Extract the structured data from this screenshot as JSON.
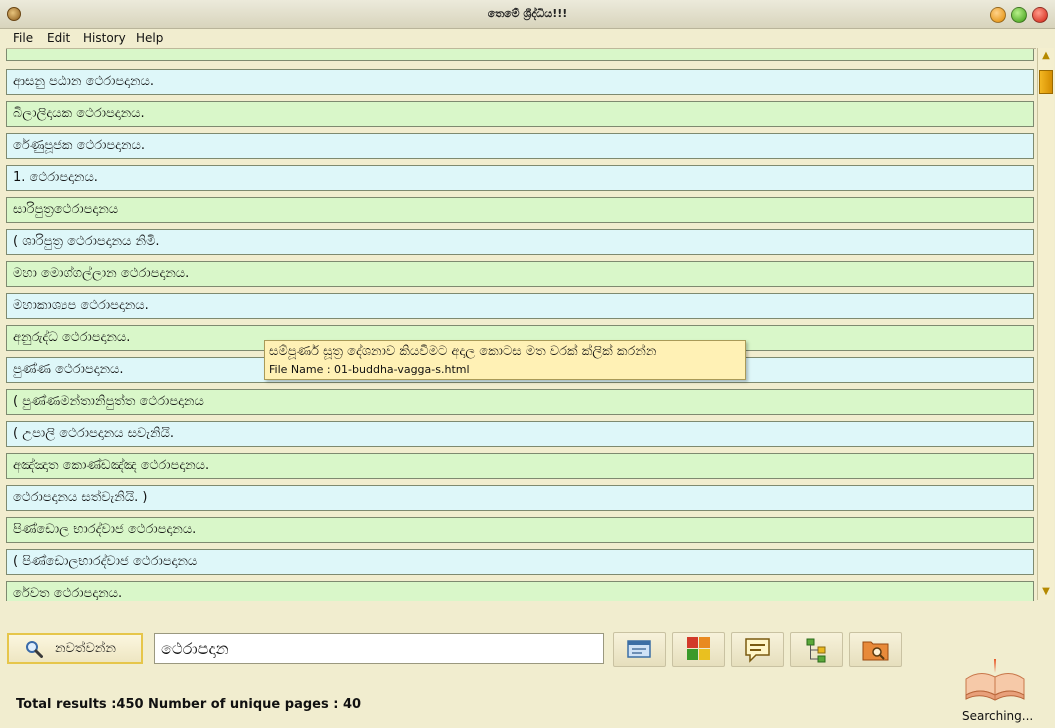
{
  "window": {
    "title": "තෙමේ ශ්‍රීද්ධිය!!!"
  },
  "menu": {
    "file": "File",
    "edit": "Edit",
    "history": "History",
    "help": "Help"
  },
  "results": [
    "ආසනු පඨාන ථෙරාපදානය.",
    "බිලාලිදායක ථෙරාපදානය.",
    "රේණුපූජක ථෙරාපදානය.",
    "1. ථෙරාපදානය.",
    "සාරිපුත්‍රථෙරාපදානය",
    "( ශාරිපුත්‍ර ථෙරාපදානය නිමි.",
    "මහා මොග්ගල්ලාන ථෙරාපදානය.",
    "මහාකාශ්‍යප ථෙරාපදානය.",
    "අනුරුද්ධ ථෙරාපදානය.",
    "පුණ්ණ ථෙරාපදානය.",
    "( පුණ්ණමන්තානිපුත්ත ථෙරාපදානය",
    "( උපාලි ථෙරාපදානය සවැනියි.",
    "අඤ්ඤාත කොණ්ඩඤ්ඤ ථෙරාපදානය.",
    "ථෙරාපදානය සත්වැනියි. )",
    "පිණ්ඩොල භාරද්වාජ ථෙරාපදානය.",
    "( පිණ්ඩොලභාරද්වාජ ථෙරාපදානය",
    "රේවත ථෙරාපදානය."
  ],
  "tooltip": {
    "line1": "සම්පූර්ණ සූත්‍ර දේශනාව කියවීමට අදාල කොටස මත වරක් ක්ලික් කරන්න",
    "line2": "File Name : 01-buddha-vagga-s.html"
  },
  "toolbar": {
    "stop_label": "නවත්වන්න",
    "search_value": "ථෙරාපදාන"
  },
  "status": {
    "text": "Total results :450  Number of unique pages : 40",
    "searching": "Searching..."
  },
  "colors": {
    "row_green": "#d9f7c9",
    "row_blue": "#def7f9",
    "accent": "#f3b722"
  }
}
